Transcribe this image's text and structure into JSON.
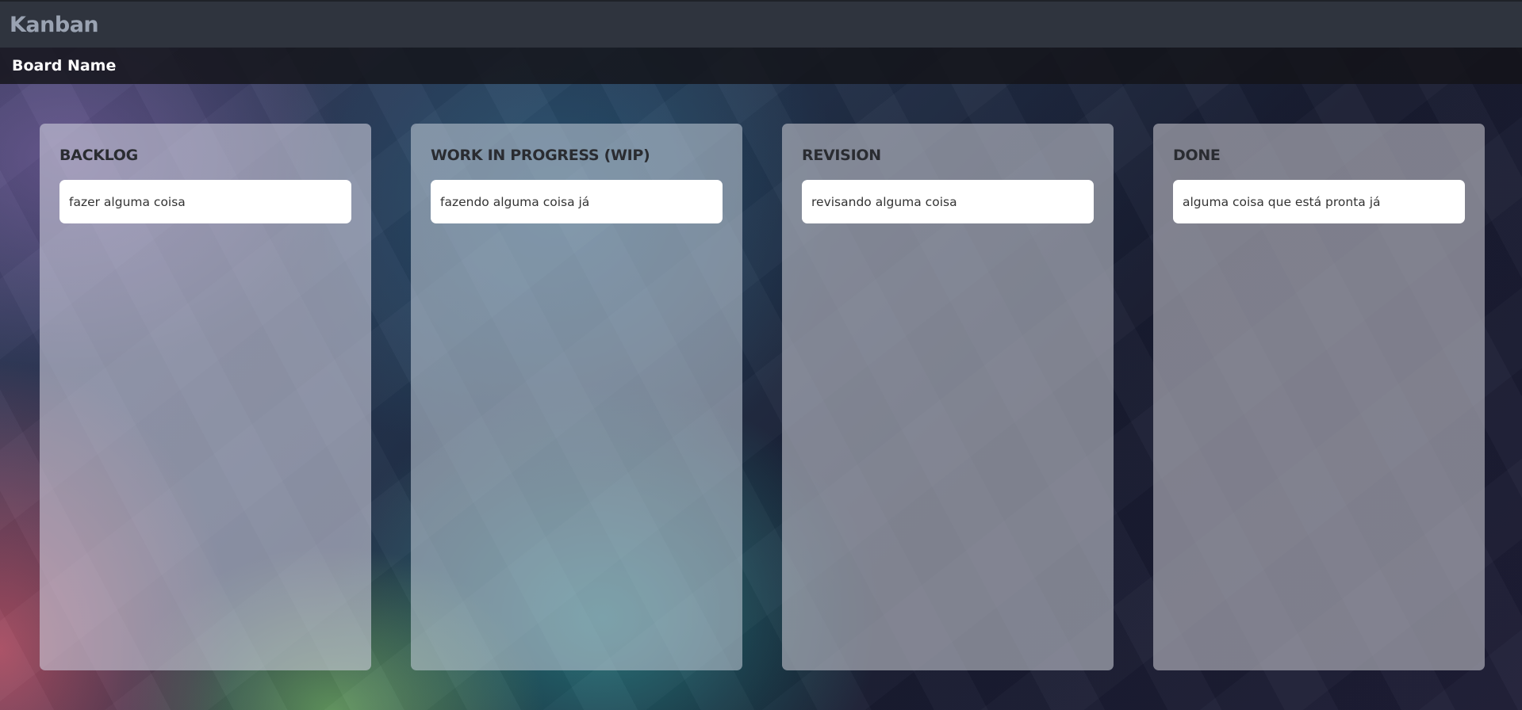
{
  "app": {
    "title": "Kanban"
  },
  "board": {
    "name": "Board Name"
  },
  "columns": [
    {
      "title": "BACKLOG",
      "cards": [
        {
          "text": "fazer alguma coisa"
        }
      ]
    },
    {
      "title": "WORK IN PROGRESS (WIP)",
      "cards": [
        {
          "text": "fazendo alguma coisa já"
        }
      ]
    },
    {
      "title": "REVISION",
      "cards": [
        {
          "text": "revisando alguma coisa"
        }
      ]
    },
    {
      "title": "DONE",
      "cards": [
        {
          "text": "alguma coisa que está pronta já"
        }
      ]
    }
  ],
  "colors": {
    "navbar": "#2f343e",
    "brand_text": "#9aa3b2",
    "board_bar": "#141418",
    "card": "#ffffff"
  }
}
